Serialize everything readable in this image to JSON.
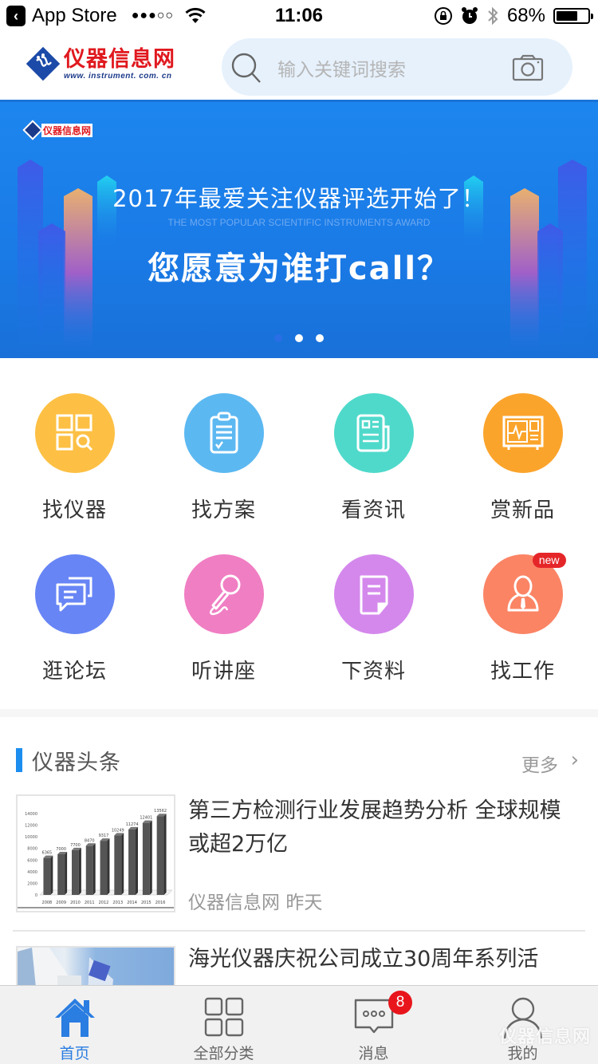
{
  "status_bar": {
    "back_app": "App Store",
    "signal": "●●●○○",
    "time": "11:06",
    "battery": "68%",
    "battery_level": 0.68
  },
  "header": {
    "logo_cn": "仪器信息网",
    "logo_url": "www. instrument. com. cn",
    "search_placeholder": "输入关键词搜索"
  },
  "banner": {
    "logo_text": "仪器信息网",
    "title": "2017年最爱关注仪器评选开始了！",
    "subtitle": "THE MOST POPULAR SCIENTIFIC INSTRUMENTS AWARD",
    "headline": "您愿意为谁打call？",
    "slides": 3,
    "active_slide": 0
  },
  "menu": [
    {
      "label": "找仪器",
      "icon": "instrument-search-icon",
      "color": "#fdc044"
    },
    {
      "label": "找方案",
      "icon": "clipboard-icon",
      "color": "#5cb8f1"
    },
    {
      "label": "看资讯",
      "icon": "newspaper-icon",
      "color": "#4fd9cb"
    },
    {
      "label": "赏新品",
      "icon": "monitor-icon",
      "color": "#fba42c"
    },
    {
      "label": "逛论坛",
      "icon": "chat-bubbles-icon",
      "color": "#6785f5"
    },
    {
      "label": "听讲座",
      "icon": "microphone-icon",
      "color": "#f07ec3"
    },
    {
      "label": "下资料",
      "icon": "document-icon",
      "color": "#d488ec"
    },
    {
      "label": "找工作",
      "icon": "job-person-icon",
      "color": "#fb8465",
      "badge": "new"
    }
  ],
  "news_section": {
    "title": "仪器头条",
    "more": "更多",
    "items": [
      {
        "title": "第三方检测行业发展趋势分析 全球规模或超2万亿",
        "source": "仪器信息网",
        "time": "昨天",
        "thumbnail": "bar-chart-thumbnail"
      },
      {
        "title": "海光仪器庆祝公司成立30周年系列活",
        "thumbnail": "building-photo-thumbnail"
      }
    ]
  },
  "chart_data": {
    "type": "bar",
    "categories": [
      "2008",
      "2009",
      "2010",
      "2011",
      "2012",
      "2013",
      "2014",
      "2015",
      "2016"
    ],
    "values": [
      6365,
      7000,
      7700,
      8470,
      9317,
      10249,
      11274,
      12401,
      13562
    ],
    "title": "",
    "xlabel": "",
    "ylabel": "",
    "yticks": [
      0,
      2000,
      4000,
      6000,
      8000,
      10000,
      12000,
      14000
    ],
    "ylim": [
      0,
      14000
    ]
  },
  "tabbar": {
    "tabs": [
      {
        "label": "首页",
        "icon": "home-icon",
        "active": true
      },
      {
        "label": "全部分类",
        "icon": "grid-icon"
      },
      {
        "label": "消息",
        "icon": "message-icon",
        "badge": "8"
      },
      {
        "label": "我的",
        "icon": "user-icon"
      }
    ],
    "watermark": "仪器信息网"
  },
  "colors": {
    "accent": "#1a73d9",
    "active_tab": "#2a7de1",
    "badge": "#e8161c",
    "logo_red": "#e0191f"
  }
}
